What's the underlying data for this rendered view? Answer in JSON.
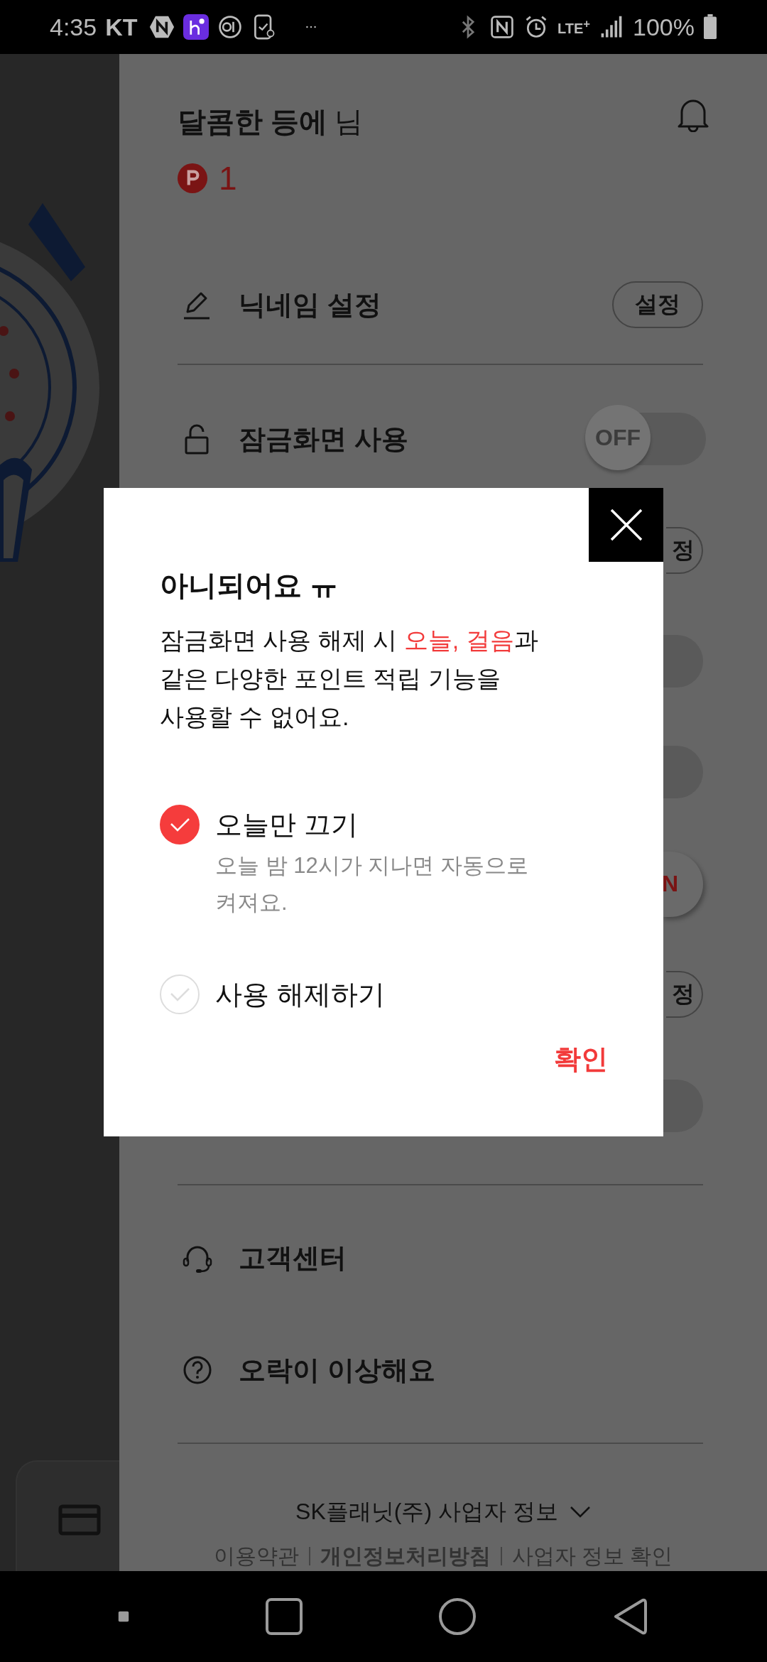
{
  "status_bar": {
    "time": "4:35",
    "carrier": "KT",
    "network": "LTE$^{+}$",
    "battery": "100%"
  },
  "drawer": {
    "user_name": "달콤한 등에",
    "user_suffix": "님",
    "points": "1",
    "rows": [
      {
        "kind": "button",
        "label": "닉네임 설정",
        "button": "설정"
      },
      {
        "kind": "toggle",
        "label": "잠금화면 사용",
        "on": false,
        "toggle_text": "OFF"
      }
    ],
    "hidden_rows": [
      {
        "kind": "button",
        "button": "정"
      },
      {
        "kind": "toggle",
        "on": false
      },
      {
        "kind": "toggle",
        "on": false
      },
      {
        "kind": "toggle",
        "on": true,
        "toggle_text": "N"
      },
      {
        "kind": "button",
        "button": "정"
      },
      {
        "kind": "toggle",
        "on": false
      }
    ],
    "links": [
      {
        "label": "고객센터"
      },
      {
        "label": "오락이 이상해요"
      }
    ],
    "footer": {
      "company": "SK플래닛(주) 사업자 정보",
      "links": [
        {
          "label": "이용약관",
          "bold": false
        },
        {
          "label": "개인정보처리방침",
          "bold": true
        },
        {
          "label": "사업자 정보 확인",
          "bold": false
        }
      ]
    }
  },
  "dialog": {
    "title": "아니되어요 ㅠ",
    "body": [
      {
        "text": "잠금화면 사용 해제 시 ",
        "highlight": false
      },
      {
        "text": "오늘, 걸음",
        "highlight": true
      },
      {
        "text": "과\n같은 다양한 포인트 적립 기능을\n사용할 수 없어요.",
        "highlight": false
      }
    ],
    "options": [
      {
        "label": "오늘만 끄기",
        "note": "오늘 밤 12시가 지나면 자동으로\n켜져요.",
        "selected": true
      },
      {
        "label": "사용 해제하기",
        "selected": false
      }
    ],
    "confirm": "확인"
  }
}
